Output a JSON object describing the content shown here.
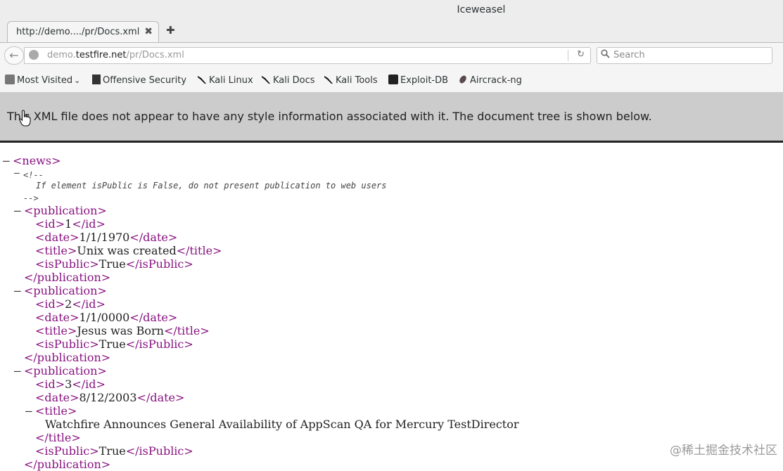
{
  "window": {
    "title": "Iceweasel"
  },
  "tab": {
    "label": "http://demo..../pr/Docs.xml",
    "close": "✖",
    "new_tab": "✚"
  },
  "nav": {
    "back": "←",
    "url_prefix": "demo.",
    "url_host": "testfire.net",
    "url_path": "/pr/Docs.xml",
    "reload": "↻",
    "search_icon": "search-icon",
    "search_placeholder": "Search"
  },
  "bookmarks": [
    {
      "label": "Most Visited",
      "icon": "most-visited-icon",
      "suffix": "⌄"
    },
    {
      "label": "Offensive Security",
      "icon": "offsec-icon"
    },
    {
      "label": "Kali Linux",
      "icon": "kali-icon"
    },
    {
      "label": "Kali Docs",
      "icon": "kali-icon"
    },
    {
      "label": "Kali Tools",
      "icon": "kali-icon"
    },
    {
      "label": "Exploit-DB",
      "icon": "exploit-db-icon"
    },
    {
      "label": "Aircrack-ng",
      "icon": "aircrack-icon"
    }
  ],
  "info_message": "This XML file does not appear to have any style information associated with it. The document tree is shown below.",
  "xml": {
    "root_open": "<news>",
    "comment_open": "<!--",
    "comment_text": "If element isPublic is False, do not present publication to web users",
    "comment_close": "-->",
    "pub_open": "<publication>",
    "pub_close": "</publication>",
    "publications": [
      {
        "id_line": "<id>1</id>",
        "id_open": "<id>",
        "id": "1",
        "id_close": "</id>",
        "date_open": "<date>",
        "date": "1/1/1970",
        "date_close": "</date>",
        "title_open": "<title>",
        "title": "Unix was created",
        "title_close": "</title>",
        "pub_open": "<isPublic>",
        "is_public": "True",
        "pub_close": "</isPublic>"
      },
      {
        "id_open": "<id>",
        "id": "2",
        "id_close": "</id>",
        "date_open": "<date>",
        "date": "1/1/0000",
        "date_close": "</date>",
        "title_open": "<title>",
        "title": "Jesus was Born",
        "title_close": "</title>",
        "pub_open": "<isPublic>",
        "is_public": "True",
        "pub_close": "</isPublic>"
      },
      {
        "id_open": "<id>",
        "id": "3",
        "id_close": "</id>",
        "date_open": "<date>",
        "date": "8/12/2003",
        "date_close": "</date>",
        "title_open": "<title>",
        "title": "Watchfire Announces General Availability of AppScan QA for Mercury TestDirector",
        "title_close": "</title>",
        "pub_open": "<isPublic>",
        "is_public": "True",
        "pub_close": "</isPublic>"
      }
    ],
    "toggle": "–"
  },
  "watermark": "@稀土掘金技术社区"
}
